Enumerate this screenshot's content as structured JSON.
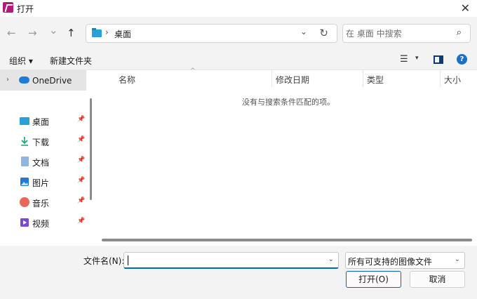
{
  "window": {
    "title": "打开",
    "close": "✕"
  },
  "nav": {
    "back": "←",
    "forward": "→",
    "recent": "⌄",
    "up": "↑"
  },
  "address": {
    "separator": "›",
    "location": "桌面",
    "dropdown": "⌄",
    "refresh": "↻"
  },
  "search": {
    "placeholder": "在 桌面 中搜索",
    "value": "",
    "icon": "⌕"
  },
  "toolbar": {
    "organize_label": "组织 ▾",
    "new_folder_label": "新建文件夹",
    "view_icon": "☰",
    "view_caret": "▾",
    "help_label": "?"
  },
  "sidebar": {
    "onedrive": {
      "chevron": "›",
      "label": "OneDrive"
    },
    "pin": "📌",
    "items": [
      {
        "label": "桌面",
        "icon": "desktop-icon"
      },
      {
        "label": "下载",
        "icon": "download-icon"
      },
      {
        "label": "文档",
        "icon": "document-icon"
      },
      {
        "label": "图片",
        "icon": "pictures-icon"
      },
      {
        "label": "音乐",
        "icon": "music-icon"
      },
      {
        "label": "视频",
        "icon": "video-icon"
      }
    ]
  },
  "content": {
    "sort_indicator": "^",
    "columns": [
      "名称",
      "修改日期",
      "类型",
      "大小"
    ],
    "empty_message": "没有与搜索条件匹配的项。"
  },
  "bottom": {
    "filename_label": "文件名(N):",
    "filename_value": "",
    "filename_drop": "⌄",
    "filetype_value": "所有可支持的图像文件",
    "filetype_drop": "⌄",
    "open_label": "打开(O)",
    "cancel_label": "取消"
  },
  "colors": {
    "accent": "#0067c0",
    "app_icon": "#b3197c",
    "folder": "#2b9fd8"
  }
}
